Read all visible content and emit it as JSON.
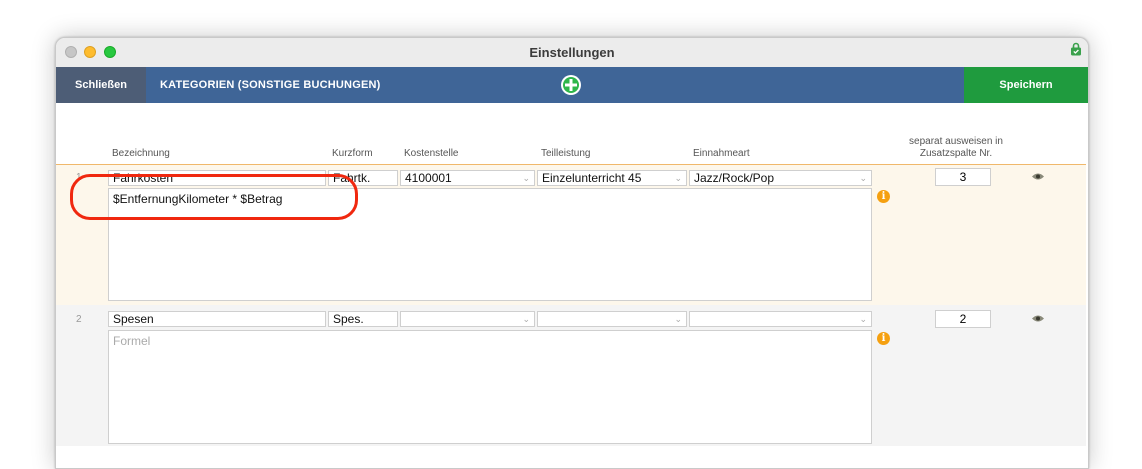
{
  "window": {
    "title": "Einstellungen"
  },
  "toolbar": {
    "close_label": "Schließen",
    "title": "KATEGORIEN (SONSTIGE BUCHUNGEN)",
    "save_label": "Speichern",
    "add_icon": "plus-circle-icon"
  },
  "columns": {
    "bezeichnung": "Bezeichnung",
    "kurzform": "Kurzform",
    "kostenstelle": "Kostenstelle",
    "teilleistung": "Teilleistung",
    "einnahmeart": "Einnahmeart",
    "separat_line1": "separat ausweisen in",
    "separat_line2": "Zusatzspalte Nr."
  },
  "rows": [
    {
      "number": "1",
      "bezeichnung": "Fahrkosten",
      "kurzform": "Fahrtk.",
      "kostenstelle": "4100001",
      "teilleistung": "Einzelunterricht 45",
      "einnahmeart": "Jazz/Rock/Pop",
      "formula": "$EntfernungKilometer * $Betrag",
      "zusatzspalte": "3"
    },
    {
      "number": "2",
      "bezeichnung": "Spesen",
      "kurzform": "Spes.",
      "kostenstelle": "",
      "teilleistung": "",
      "einnahmeart": "",
      "formula_placeholder": "Formel",
      "zusatzspalte": "2"
    }
  ],
  "colors": {
    "toolbar": "#3f6597",
    "close_button": "#4d5d76",
    "save_button": "#1f9b3e",
    "highlight": "#f0280f",
    "info": "#f5a010"
  }
}
